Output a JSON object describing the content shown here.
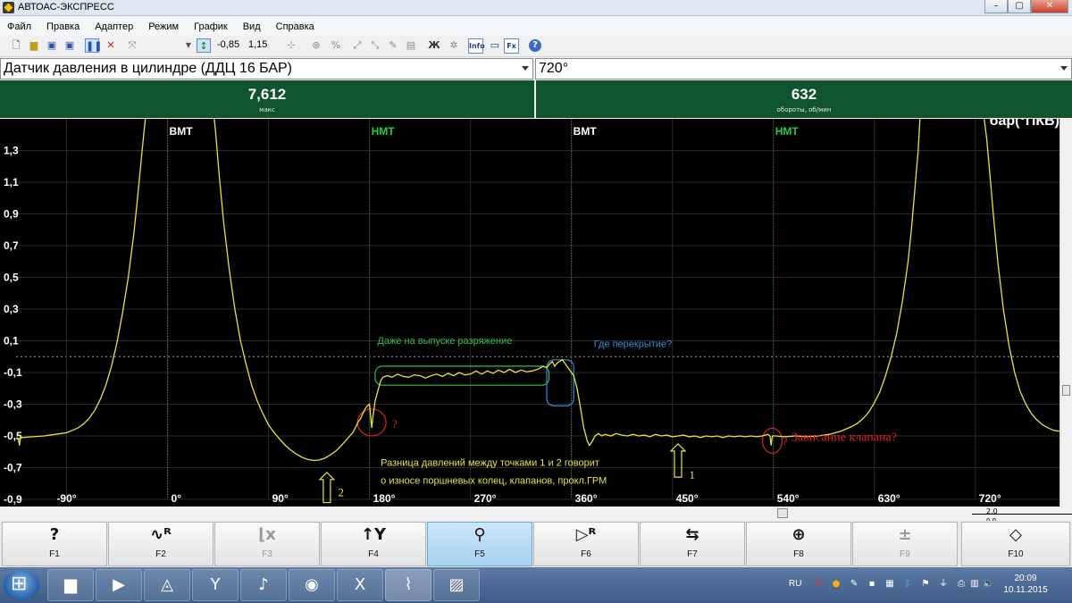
{
  "window": {
    "title": "АВТОАС-ЭКСПРЕСС",
    "min": "–",
    "max": "▢",
    "close": "✕"
  },
  "menu": [
    "Файл",
    "Правка",
    "Адаптер",
    "Режим",
    "График",
    "Вид",
    "Справка"
  ],
  "toolbar": {
    "value_min": "-0,85",
    "value_max": "1,15",
    "info_label": "Info",
    "fx_label": "Fx",
    "bold_label": "Ж",
    "help": "?"
  },
  "sensor_select": {
    "value": "Датчик давления в цилиндре (ДДЦ 16 БАР)"
  },
  "range_select": {
    "value": "720°"
  },
  "panels": [
    {
      "value": "7,612",
      "caption": "макс"
    },
    {
      "value": "632",
      "caption": "обороты, об/мин"
    }
  ],
  "chart_data": {
    "type": "line",
    "unit_label": "бар(°ПКВ)",
    "xlim": [
      -135,
      795
    ],
    "ylim": [
      -0.9,
      1.5
    ],
    "yticks": [
      {
        "v": 1.3,
        "label": "1,3"
      },
      {
        "v": 1.1,
        "label": "1,1"
      },
      {
        "v": 0.9,
        "label": "0,9"
      },
      {
        "v": 0.7,
        "label": "0,7"
      },
      {
        "v": 0.5,
        "label": "0,5"
      },
      {
        "v": 0.3,
        "label": "0,3"
      },
      {
        "v": 0.1,
        "label": "0,1"
      },
      {
        "v": -0.1,
        "label": "-0,1"
      },
      {
        "v": -0.3,
        "label": "-0,3"
      },
      {
        "v": -0.5,
        "label": "-0,5"
      },
      {
        "v": -0.7,
        "label": "-0,7"
      },
      {
        "v": -0.9,
        "label": "-0,9"
      }
    ],
    "xticks": [
      {
        "v": -90,
        "label": "-90°"
      },
      {
        "v": 0,
        "label": "0°"
      },
      {
        "v": 90,
        "label": "90°"
      },
      {
        "v": 180,
        "label": "180°"
      },
      {
        "v": 270,
        "label": "270°"
      },
      {
        "v": 360,
        "label": "360°"
      },
      {
        "v": 450,
        "label": "450°"
      },
      {
        "v": 540,
        "label": "540°"
      },
      {
        "v": 630,
        "label": "630°"
      },
      {
        "v": 720,
        "label": "720°"
      }
    ],
    "markers": [
      {
        "v": 0,
        "label": "ВМТ",
        "color": "#ffffff"
      },
      {
        "v": 180,
        "label": "НМТ",
        "color": "#22cc44"
      },
      {
        "v": 360,
        "label": "ВМТ",
        "color": "#ffffff"
      },
      {
        "v": 540,
        "label": "НМТ",
        "color": "#22cc44"
      }
    ],
    "series": [
      {
        "color": "#e8e43c",
        "points": [
          [
            -135,
            -0.515
          ],
          [
            -133,
            -0.52
          ],
          [
            -132,
            -0.56
          ],
          [
            -131,
            -0.5
          ],
          [
            -130,
            -0.51
          ],
          [
            -120,
            -0.505
          ],
          [
            -110,
            -0.5
          ],
          [
            -100,
            -0.49
          ],
          [
            -95,
            -0.485
          ],
          [
            -90,
            -0.48
          ],
          [
            -85,
            -0.465
          ],
          [
            -80,
            -0.45
          ],
          [
            -75,
            -0.425
          ],
          [
            -70,
            -0.39
          ],
          [
            -65,
            -0.34
          ],
          [
            -60,
            -0.27
          ],
          [
            -55,
            -0.18
          ],
          [
            -50,
            -0.06
          ],
          [
            -45,
            0.09
          ],
          [
            -40,
            0.28
          ],
          [
            -35,
            0.5
          ],
          [
            -30,
            0.78
          ],
          [
            -27,
            0.98
          ],
          [
            -24,
            1.2
          ],
          [
            -21,
            1.42
          ],
          [
            -19,
            1.55
          ],
          [
            41,
            1.55
          ],
          [
            43,
            1.4
          ],
          [
            46,
            1.15
          ],
          [
            50,
            0.85
          ],
          [
            55,
            0.55
          ],
          [
            60,
            0.3
          ],
          [
            65,
            0.1
          ],
          [
            70,
            -0.05
          ],
          [
            75,
            -0.18
          ],
          [
            80,
            -0.28
          ],
          [
            85,
            -0.36
          ],
          [
            90,
            -0.43
          ],
          [
            95,
            -0.48
          ],
          [
            100,
            -0.52
          ],
          [
            105,
            -0.56
          ],
          [
            110,
            -0.59
          ],
          [
            115,
            -0.615
          ],
          [
            120,
            -0.635
          ],
          [
            125,
            -0.648
          ],
          [
            130,
            -0.655
          ],
          [
            135,
            -0.652
          ],
          [
            140,
            -0.64
          ],
          [
            145,
            -0.62
          ],
          [
            150,
            -0.595
          ],
          [
            155,
            -0.56
          ],
          [
            160,
            -0.52
          ],
          [
            165,
            -0.48
          ],
          [
            168,
            -0.44
          ],
          [
            170,
            -0.41
          ],
          [
            172,
            -0.39
          ],
          [
            174,
            -0.36
          ],
          [
            176,
            -0.33
          ],
          [
            178,
            -0.31
          ],
          [
            180,
            -0.3
          ],
          [
            182,
            -0.45
          ],
          [
            183,
            -0.38
          ],
          [
            185,
            -0.28
          ],
          [
            188,
            -0.2
          ],
          [
            190,
            -0.15
          ],
          [
            192,
            -0.13
          ],
          [
            196,
            -0.12
          ],
          [
            200,
            -0.13
          ],
          [
            205,
            -0.11
          ],
          [
            210,
            -0.125
          ],
          [
            215,
            -0.13
          ],
          [
            220,
            -0.115
          ],
          [
            225,
            -0.12
          ],
          [
            230,
            -0.135
          ],
          [
            235,
            -0.12
          ],
          [
            240,
            -0.11
          ],
          [
            245,
            -0.125
          ],
          [
            250,
            -0.105
          ],
          [
            255,
            -0.12
          ],
          [
            260,
            -0.1
          ],
          [
            265,
            -0.115
          ],
          [
            270,
            -0.11
          ],
          [
            275,
            -0.09
          ],
          [
            280,
            -0.11
          ],
          [
            285,
            -0.09
          ],
          [
            290,
            -0.105
          ],
          [
            295,
            -0.085
          ],
          [
            300,
            -0.1
          ],
          [
            305,
            -0.08
          ],
          [
            310,
            -0.1
          ],
          [
            315,
            -0.085
          ],
          [
            320,
            -0.095
          ],
          [
            325,
            -0.09
          ],
          [
            330,
            -0.08
          ],
          [
            335,
            -0.06
          ],
          [
            338,
            -0.07
          ],
          [
            340,
            -0.05
          ],
          [
            343,
            -0.03
          ],
          [
            345,
            -0.06
          ],
          [
            348,
            -0.035
          ],
          [
            352,
            -0.02
          ],
          [
            355,
            -0.05
          ],
          [
            358,
            -0.08
          ],
          [
            362,
            -0.12
          ],
          [
            365,
            -0.2
          ],
          [
            368,
            -0.32
          ],
          [
            371,
            -0.45
          ],
          [
            374,
            -0.53
          ],
          [
            376,
            -0.56
          ],
          [
            378,
            -0.54
          ],
          [
            381,
            -0.5
          ],
          [
            384,
            -0.485
          ],
          [
            387,
            -0.5
          ],
          [
            390,
            -0.49
          ],
          [
            395,
            -0.5
          ],
          [
            400,
            -0.485
          ],
          [
            405,
            -0.495
          ],
          [
            410,
            -0.5
          ],
          [
            415,
            -0.49
          ],
          [
            420,
            -0.5
          ],
          [
            425,
            -0.495
          ],
          [
            430,
            -0.505
          ],
          [
            435,
            -0.49
          ],
          [
            440,
            -0.5
          ],
          [
            445,
            -0.495
          ],
          [
            450,
            -0.505
          ],
          [
            455,
            -0.5
          ],
          [
            460,
            -0.495
          ],
          [
            465,
            -0.505
          ],
          [
            470,
            -0.5
          ],
          [
            475,
            -0.51
          ],
          [
            480,
            -0.5
          ],
          [
            485,
            -0.505
          ],
          [
            490,
            -0.5
          ],
          [
            495,
            -0.51
          ],
          [
            500,
            -0.5
          ],
          [
            505,
            -0.505
          ],
          [
            510,
            -0.5
          ],
          [
            515,
            -0.505
          ],
          [
            520,
            -0.5
          ],
          [
            525,
            -0.505
          ],
          [
            530,
            -0.5
          ],
          [
            535,
            -0.49
          ],
          [
            537,
            -0.5
          ],
          [
            538,
            -0.56
          ],
          [
            539,
            -0.5
          ],
          [
            542,
            -0.5
          ],
          [
            550,
            -0.505
          ],
          [
            560,
            -0.5
          ],
          [
            570,
            -0.505
          ],
          [
            580,
            -0.5
          ],
          [
            590,
            -0.49
          ],
          [
            600,
            -0.47
          ],
          [
            610,
            -0.44
          ],
          [
            615,
            -0.42
          ],
          [
            620,
            -0.39
          ],
          [
            625,
            -0.35
          ],
          [
            630,
            -0.29
          ],
          [
            635,
            -0.22
          ],
          [
            640,
            -0.12
          ],
          [
            645,
            0.0
          ],
          [
            650,
            0.15
          ],
          [
            655,
            0.35
          ],
          [
            660,
            0.6
          ],
          [
            663,
            0.8
          ],
          [
            666,
            1.05
          ],
          [
            669,
            1.3
          ],
          [
            671,
            1.55
          ],
          [
            727,
            1.55
          ],
          [
            730,
            1.38
          ],
          [
            733,
            1.15
          ],
          [
            736,
            0.9
          ],
          [
            740,
            0.6
          ],
          [
            745,
            0.3
          ],
          [
            750,
            0.07
          ],
          [
            755,
            -0.1
          ],
          [
            760,
            -0.22
          ],
          [
            765,
            -0.3
          ],
          [
            770,
            -0.36
          ],
          [
            775,
            -0.4
          ],
          [
            780,
            -0.43
          ],
          [
            785,
            -0.45
          ],
          [
            790,
            -0.465
          ],
          [
            795,
            -0.47
          ]
        ]
      }
    ],
    "annotations": [
      {
        "text": "Даже на выпуске разряжение",
        "color": "#2fbf4a"
      },
      {
        "text": "Где перекрытие?",
        "color": "#2f8fd8"
      },
      {
        "text": "Зависание клапана?",
        "color": "#e02020"
      },
      {
        "text": "?",
        "color": "#e02020"
      },
      {
        "text": "?",
        "color": "#e02020"
      },
      {
        "text": "Разница давлений между точками 1 и 2 говорит",
        "color": "#e8e43c"
      },
      {
        "text": "о износе поршневых колец, клапанов, прокл.ГРМ",
        "color": "#e8e43c"
      },
      {
        "text": "1",
        "color": "#e8e43c"
      },
      {
        "text": "2",
        "color": "#e8e43c"
      }
    ]
  },
  "mini_scale": {
    "top": "2,0",
    "bottom": "0,0"
  },
  "fkeys": [
    {
      "icon": "?",
      "label": "F1",
      "state": "normal"
    },
    {
      "icon": "∿ᴿ",
      "label": "F2",
      "state": "normal"
    },
    {
      "icon": "⌊x",
      "label": "F3",
      "state": "disabled"
    },
    {
      "icon": "↑Y",
      "label": "F4",
      "state": "normal"
    },
    {
      "icon": "⚲",
      "label": "F5",
      "state": "active"
    },
    {
      "icon": "▷ᴿ",
      "label": "F6",
      "state": "normal"
    },
    {
      "icon": "⇆",
      "label": "F7",
      "state": "normal"
    },
    {
      "icon": "⊕",
      "label": "F8",
      "state": "normal"
    },
    {
      "icon": "±",
      "label": "F9",
      "state": "disabled"
    },
    {
      "icon": "◇",
      "label": "F10",
      "state": "normal"
    }
  ],
  "taskbar": {
    "lang": "RU",
    "time": "20:09",
    "date": "10.11.2015",
    "apps": [
      "folder-icon",
      "media-player-icon",
      "autoas-icon",
      "yandex-browser-icon",
      "audio-icon",
      "chrome-icon",
      "excel-icon",
      "oscilloscope-icon",
      "image-viewer-icon"
    ]
  }
}
